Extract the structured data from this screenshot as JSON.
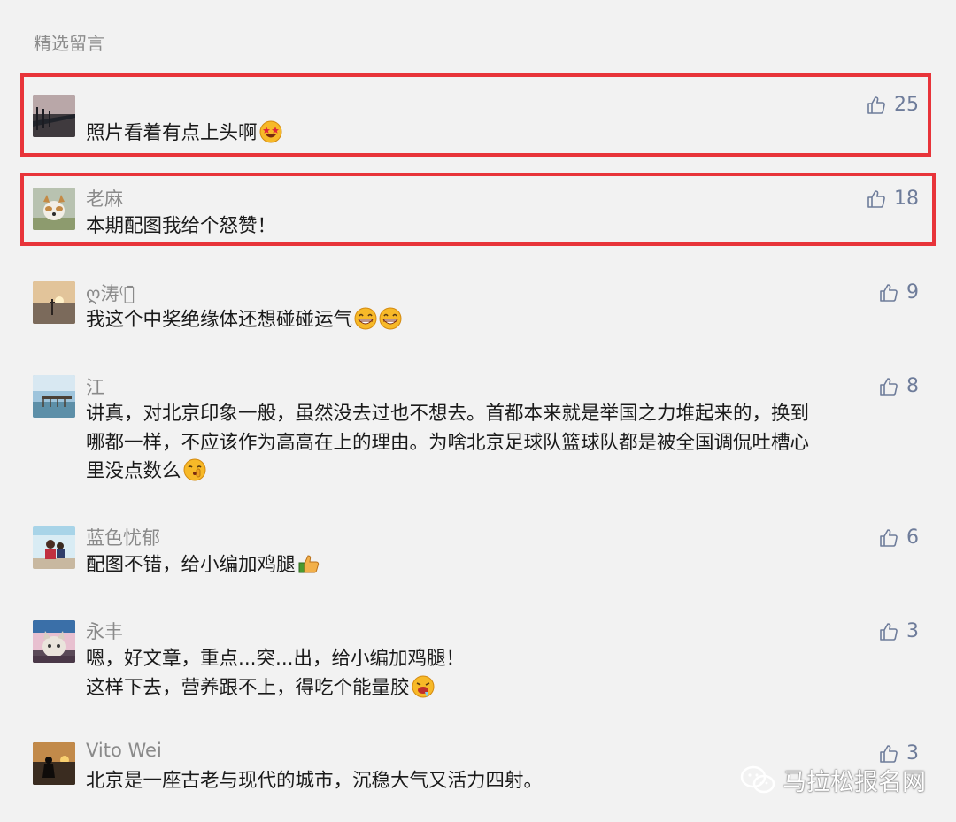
{
  "section_title": "精选留言",
  "watermark": "马拉松报名网",
  "colors": {
    "highlight": "#e8343a",
    "like": "#6e7c9a",
    "name": "#8a8a8a"
  },
  "comments": [
    {
      "name": "",
      "lines": [
        "照片看着有点上头啊"
      ],
      "likes": "25",
      "avatar": "bridge-sunset-photo",
      "emoji": "star-eyes"
    },
    {
      "name": "老麻",
      "lines": [
        "本期配图我给个怒赞！"
      ],
      "likes": "18",
      "avatar": "dog-photo",
      "emoji": ""
    },
    {
      "name": "ღ涛⁽ঞ̄ ",
      "lines": [
        "我这个中奖绝缘体还想碰碰运气"
      ],
      "likes": "9",
      "avatar": "beach-sunset-photo",
      "emoji": "grin-grin"
    },
    {
      "name": "江",
      "lines": [
        "讲真，对北京印象一般，虽然没去过也不想去。首都本来就是举国之力堆起来的，换到",
        "哪都一样，不应该作为高高在上的理由。为啥北京足球队篮球队都是被全国调侃吐槽心",
        "里没点数么"
      ],
      "likes": "8",
      "avatar": "lake-pier-photo",
      "emoji": "shush"
    },
    {
      "name": "蓝色忧郁",
      "lines": [
        "配图不错，给小编加鸡腿"
      ],
      "likes": "6",
      "avatar": "people-photo",
      "emoji": "thumbs-up"
    },
    {
      "name": "永丰",
      "lines": [
        "嗯，好文章，重点...突...出，给小编加鸡腿！",
        "这样下去，营养跟不上，得吃个能量胶"
      ],
      "likes": "3",
      "avatar": "cat-photo",
      "emoji": "drool"
    },
    {
      "name": "Vito Wei",
      "lines": [
        "北京是一座古老与现代的城市，沉稳大气又活力四射。"
      ],
      "likes": "3",
      "avatar": "silhouette-sunset-photo",
      "emoji": ""
    }
  ]
}
